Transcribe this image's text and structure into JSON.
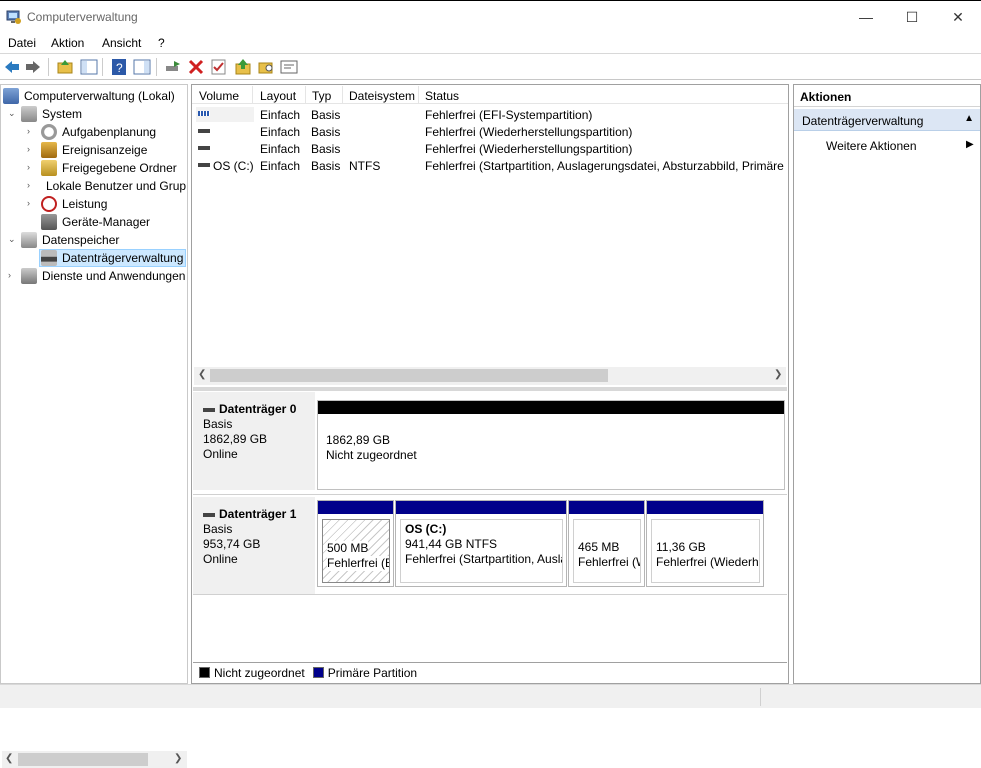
{
  "window": {
    "title": "Computerverwaltung"
  },
  "menu": [
    "Datei",
    "Aktion",
    "Ansicht",
    "?"
  ],
  "tree": {
    "root": "Computerverwaltung (Lokal)",
    "system": "System",
    "items": [
      "Aufgabenplanung",
      "Ereignisanzeige",
      "Freigegebene Ordner",
      "Lokale Benutzer und Gruppen",
      "Leistung",
      "Geräte-Manager"
    ],
    "datenspeicher": "Datenspeicher",
    "disk_mgmt": "Datenträgerverwaltung",
    "services": "Dienste und Anwendungen"
  },
  "list": {
    "columns": [
      "Volume",
      "Layout",
      "Typ",
      "Dateisystem",
      "Status"
    ],
    "rows": [
      {
        "volume": "",
        "layout": "Einfach",
        "typ": "Basis",
        "fs": "",
        "status": "Fehlerfrei (EFI-Systempartition)"
      },
      {
        "volume": "",
        "layout": "Einfach",
        "typ": "Basis",
        "fs": "",
        "status": "Fehlerfrei (Wiederherstellungspartition)"
      },
      {
        "volume": "",
        "layout": "Einfach",
        "typ": "Basis",
        "fs": "",
        "status": "Fehlerfrei (Wiederherstellungspartition)"
      },
      {
        "volume": "OS (C:)",
        "layout": "Einfach",
        "typ": "Basis",
        "fs": "NTFS",
        "status": "Fehlerfrei (Startpartition, Auslagerungsdatei, Absturzabbild, Primäre Partition)"
      }
    ]
  },
  "disks": [
    {
      "name": "Datenträger 0",
      "type": "Basis",
      "size": "1862,89 GB",
      "state": "Online",
      "partitions": [
        {
          "title": "",
          "line1": "1862,89 GB",
          "line2": "Nicht zugeordnet"
        }
      ]
    },
    {
      "name": "Datenträger 1",
      "type": "Basis",
      "size": "953,74 GB",
      "state": "Online",
      "partitions": [
        {
          "title": "",
          "line1": "500 MB",
          "line2": "Fehlerfrei (EFI-Systempartition)"
        },
        {
          "title": "OS  (C:)",
          "line1": "941,44 GB NTFS",
          "line2": "Fehlerfrei (Startpartition, Auslagerungsdatei, Absturzabbild, Primäre Partition)"
        },
        {
          "title": "",
          "line1": "465 MB",
          "line2": "Fehlerfrei (Wiederherstellungspartition)"
        },
        {
          "title": "",
          "line1": "11,36 GB",
          "line2": "Fehlerfrei (Wiederherstellungspartition)"
        }
      ]
    }
  ],
  "legend": [
    "Nicht zugeordnet",
    "Primäre Partition"
  ],
  "actions": {
    "title": "Aktionen",
    "section": "Datenträgerverwaltung",
    "more": "Weitere Aktionen"
  },
  "colors": {
    "unallocated": "#000000",
    "primary": "#00008b",
    "selection": "#cce8ff"
  }
}
